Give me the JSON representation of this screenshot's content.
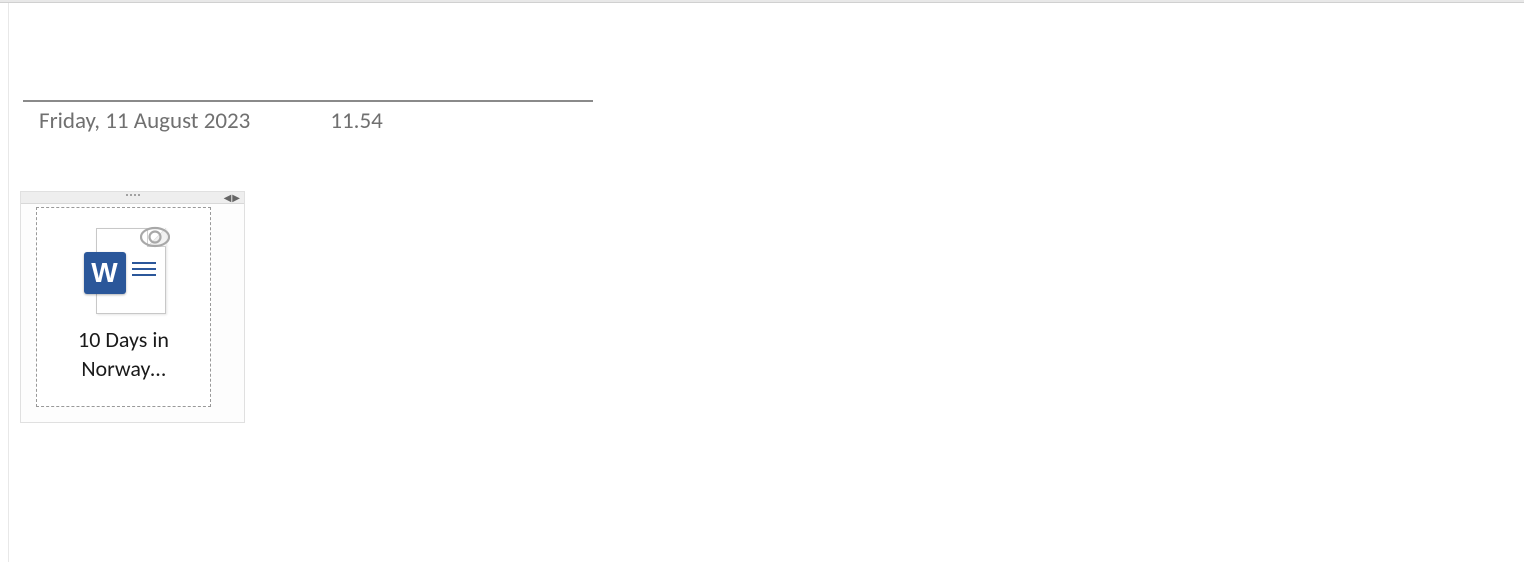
{
  "note": {
    "date": "Friday, 11 August 2023",
    "time": "11.54"
  },
  "attachment": {
    "file_name_line1": "10 Days in",
    "file_name_line2": "Norway…",
    "file_type": "word-document",
    "word_badge_letter": "W"
  }
}
